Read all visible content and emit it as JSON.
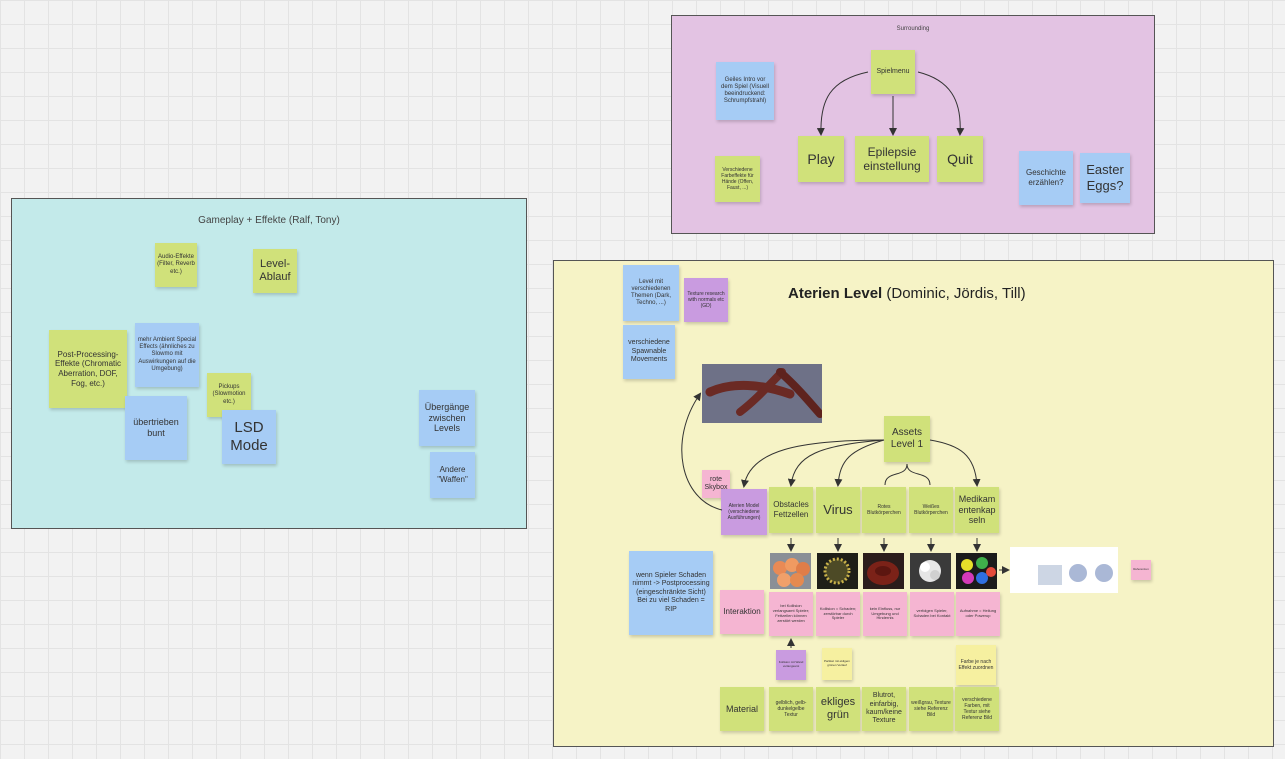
{
  "colors": {
    "frame_gameplay": "#c3eaea",
    "frame_surrounding": "#e3c3e3",
    "frame_aterien": "#f6f3c6",
    "sticky_yellow": "#d0e17a",
    "sticky_blue": "#a6ccf5",
    "sticky_pink": "#f5b5d2",
    "sticky_violet": "#c99be0",
    "sticky_light_yellow": "#f6f0a0"
  },
  "gameplay": {
    "title": "Gameplay + Effekte (Ralf, Tony)",
    "notes": {
      "audio": "Audio-Effekte (Filter, Reverb etc.)",
      "level_ablauf": "Level-Ablauf",
      "post_processing": "Post-Processing-Effekte (Chromatic Aberration, DOF, Fog, etc.)",
      "ambient": "mehr Ambient Special Effects (ähnliches zu Slowmo mit Auswirkungen auf die Umgebung)",
      "pickups": "Pickups (Slowmotion etc.)",
      "uebertrieben": "übertrieben bunt",
      "lsd": "LSD Mode",
      "uebergaenge": "Übergänge zwischen Levels",
      "waffen": "Andere \"Waffen\""
    }
  },
  "surrounding": {
    "title": "Surrounding",
    "notes": {
      "intro": "Geiles Intro vor dem Spiel (Visuell beeindruckend: Schrumpfstrahl)",
      "spielmenu": "Spielmenu",
      "play": "Play",
      "epilepsie": "Epilepsie einstellung",
      "quit": "Quit",
      "farbeffekte": "Verschiedene Farbeffekte für Hände (Offen, Faust, ...)",
      "geschichte": "Geschichte erzählen?",
      "easter_eggs": "Easter Eggs?"
    }
  },
  "aterien": {
    "title_bold": "Aterien Level",
    "title_rest": "(Dominic, Jördis, Till)",
    "notes": {
      "themen": "Level mit verschiedenen Themen (Dark, Techno, ...)",
      "texture_research": "Texture research with normals etc (GD)",
      "spawnable": "verschiedene Spawnable Movements",
      "assets": "Assets Level 1",
      "rote_skybox": "rote Skybox",
      "aterien_model": "Aterien Model (verschiedene Ausführungen)",
      "obstacles": "Obstacles Fettzellen",
      "virus": "Virus",
      "rotes_blut": "Rotes Blutkörperchen",
      "weisses_blut": "Weißes Blutkörperchen",
      "medikamente": "Medikamentenkapseln",
      "schaden": "wenn Spieler Schaden nimmt -> Postprocessing (eingeschränkte Sicht) Bei zu viel Schaden = RIP",
      "interaktion": "Interaktion",
      "inter_obstacles": "bei Kollision verlangsamt Spieler; Fettzellen können zerstört werden",
      "inter_virus": "Kollision = Schaden; zerstörbar durch Spieler",
      "inter_rotes": "kein Einfluss, nur Umgebung und Hindernis",
      "inter_weisses": "verfolgen Spieler, Schaden bei Kontakt",
      "inter_medikamente": "Aufnahme = Heilung oder Powerup",
      "note_small_violet": "Kollision mit Wand verlangsamt",
      "note_small_yellow": "Partikel mit ekligem grünen Verlauf",
      "note_medi_yellow": "Farbe je nach Effekt zuordnen",
      "small_pink": "Referenzen",
      "material": "Material",
      "mat_obstacles": "gelblich, gelb-dunkelgelbe Textur",
      "mat_virus": "ekliges grün",
      "mat_rotes": "Blutrot, einfarbig, kaum/keine Texture",
      "mat_weisses": "weißgrau, Texture siehe Referenz Bild",
      "mat_medikamente": "verschiedene Farben, mit Textur siehe Referenz Bild"
    }
  }
}
